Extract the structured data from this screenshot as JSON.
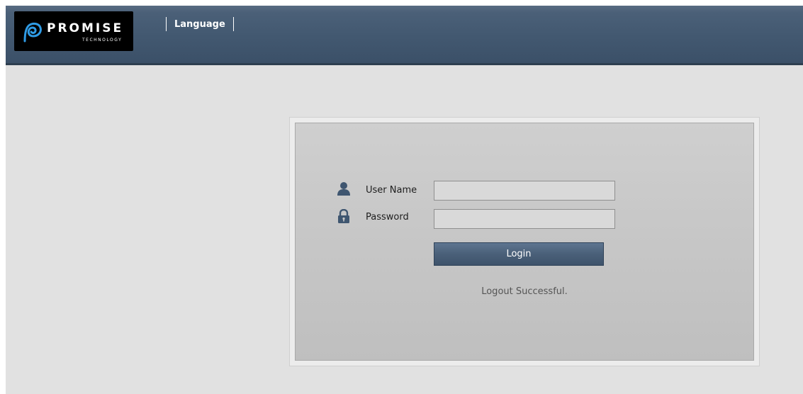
{
  "header": {
    "logo": {
      "word": "PROMISE",
      "sub": "TECHNOLOGY"
    },
    "nav": {
      "language_label": "Language"
    }
  },
  "login": {
    "username": {
      "label": "User Name",
      "value": "",
      "icon": "user-icon"
    },
    "password": {
      "label": "Password",
      "value": "",
      "icon": "lock-icon"
    },
    "submit_label": "Login",
    "status_message": "Logout Successful."
  },
  "colors": {
    "header_bg": "#425870",
    "page_bg": "#e1e1e1",
    "button_bg": "#4a6079",
    "logo_accent": "#2f9be5"
  }
}
